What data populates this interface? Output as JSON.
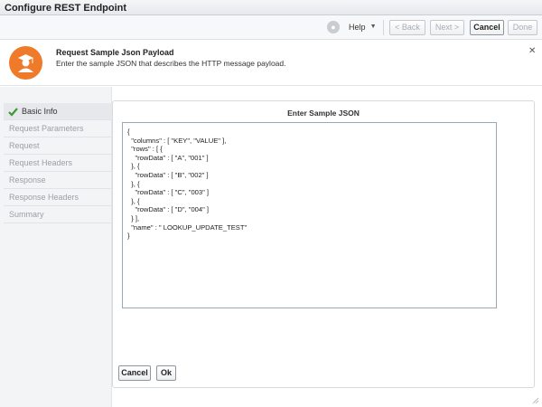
{
  "window": {
    "title": "Configure REST Endpoint"
  },
  "toolbar": {
    "help_label": "Help",
    "back_label": "< Back",
    "next_label": "Next >",
    "cancel_label": "Cancel",
    "done_label": "Done"
  },
  "banner": {
    "title": "Request Sample Json Payload",
    "subtitle": "Enter the sample JSON that describes the HTTP message payload.",
    "avatar_color": "#ee7a2a"
  },
  "sidebar": {
    "items": [
      {
        "label": "Basic Info",
        "completed": true
      },
      {
        "label": "Request Parameters"
      },
      {
        "label": "Request"
      },
      {
        "label": "Request Headers"
      },
      {
        "label": "Response"
      },
      {
        "label": "Response Headers"
      },
      {
        "label": "Summary"
      }
    ]
  },
  "main": {
    "heading": "Enter Sample JSON",
    "json_value": "{\n  \"columns\" : [ \"KEY\", \"VALUE\" ],\n  \"rows\" : [ {\n    \"rowData\" : [ \"A\", \"001\" ]\n  }, {\n    \"rowData\" : [ \"B\", \"002\" ]\n  }, {\n    \"rowData\" : [ \"C\", \"003\" ]\n  }, {\n    \"rowData\" : [ \"D\", \"004\" ]\n  } ],\n  \"name\" : \" LOOKUP_UPDATE_TEST\"\n}",
    "cancel_label": "Cancel",
    "ok_label": "Ok"
  }
}
